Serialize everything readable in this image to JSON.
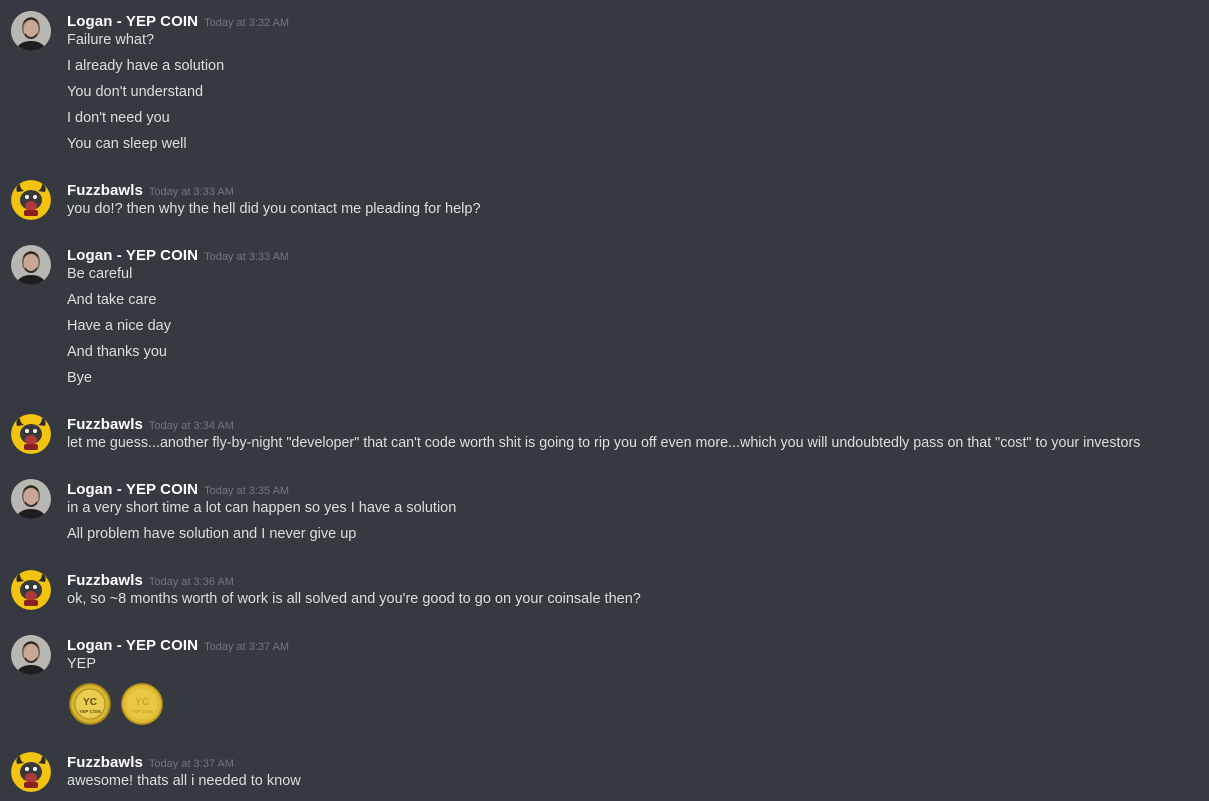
{
  "messages": [
    {
      "user": "logan",
      "username": "Logan - YEP COIN",
      "timestamp": "Today at 3:32 AM",
      "lines": [
        "Failure what?",
        "I already have a solution",
        "You don't understand",
        "I don't need you",
        "You can sleep well"
      ]
    },
    {
      "user": "fuzz",
      "username": "Fuzzbawls",
      "timestamp": "Today at 3:33 AM",
      "lines": [
        "you do!? then why the hell did you contact me pleading for help?"
      ]
    },
    {
      "user": "logan",
      "username": "Logan - YEP COIN",
      "timestamp": "Today at 3:33 AM",
      "lines": [
        "Be careful",
        "And take care",
        "Have a nice day",
        "And thanks you",
        "Bye"
      ]
    },
    {
      "user": "fuzz",
      "username": "Fuzzbawls",
      "timestamp": "Today at 3:34 AM",
      "lines": [
        "let me guess...another fly-by-night \"developer\" that can't code worth shit is going to rip you off even more...which you will undoubtedly pass on that \"cost\" to your investors"
      ]
    },
    {
      "user": "logan",
      "username": "Logan - YEP COIN",
      "timestamp": "Today at 3:35 AM",
      "lines": [
        "in a very short time a lot can happen so yes I have a solution",
        "All problem have solution and I never give up"
      ]
    },
    {
      "user": "fuzz",
      "username": "Fuzzbawls",
      "timestamp": "Today at 3:36 AM",
      "lines": [
        "ok, so ~8 months worth of work is all solved and you're good to go on your coinsale then?"
      ]
    },
    {
      "user": "logan",
      "username": "Logan - YEP COIN",
      "timestamp": "Today at 3:37 AM",
      "lines": [
        "YEP"
      ],
      "emojis": [
        {
          "name": "yepcoin-emoji-1",
          "text_top": "YC",
          "text_bottom": "YEP COIN"
        },
        {
          "name": "yepcoin-emoji-2",
          "text_top": "YC",
          "text_bottom": "YEP COIN"
        }
      ]
    },
    {
      "user": "fuzz",
      "username": "Fuzzbawls",
      "timestamp": "Today at 3:37 AM",
      "lines": [
        "awesome! thats all i needed to know"
      ]
    }
  ],
  "colors": {
    "background": "#36393f",
    "username": "#ffffff",
    "timestamp": "#72767d",
    "text": "#dcddde",
    "coin_gold": "#d4b12a"
  }
}
